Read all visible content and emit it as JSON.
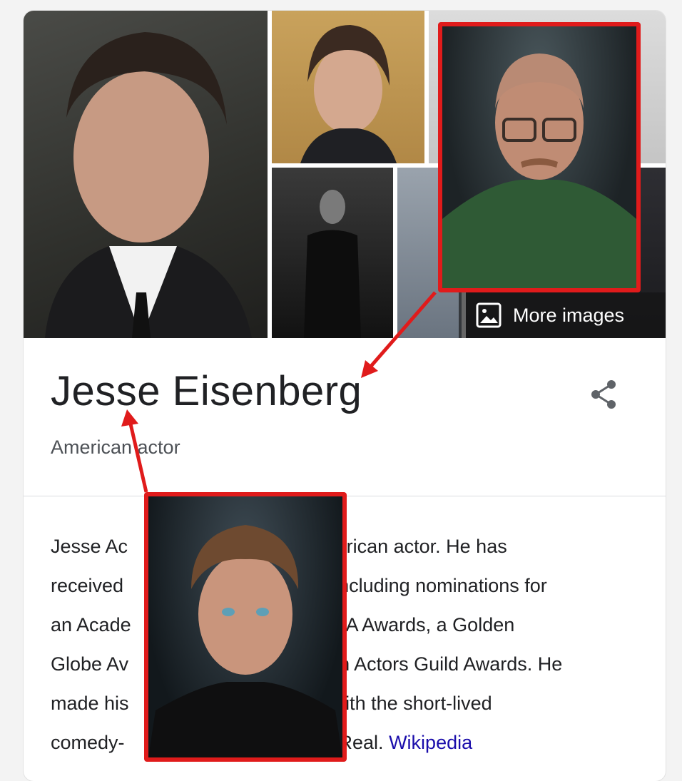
{
  "knowledge_panel": {
    "more_images_label": "More images",
    "title": "Jesse Eisenberg",
    "subtitle": "American actor",
    "description_lines": [
      {
        "a": "Jesse Ac",
        "b": "n American actor. He has"
      },
      {
        "a": "received",
        "b": ", including nominations for"
      },
      {
        "a": "an Acade",
        "b": "FTA Awards, a Golden"
      },
      {
        "a": "Globe Av",
        "b": "en Actors Guild Awards. He"
      },
      {
        "a": "made his",
        "b": "vith the short-lived"
      },
      {
        "a": "comedy-",
        "b": "Real."
      }
    ],
    "wiki_link": "Wikipedia"
  },
  "icons": {
    "image": "image-icon",
    "share": "share-icon"
  },
  "colors": {
    "highlight_border": "#e01b1b",
    "link": "#1a0dab",
    "text": "#202124",
    "secondary_text": "#4d5156"
  }
}
